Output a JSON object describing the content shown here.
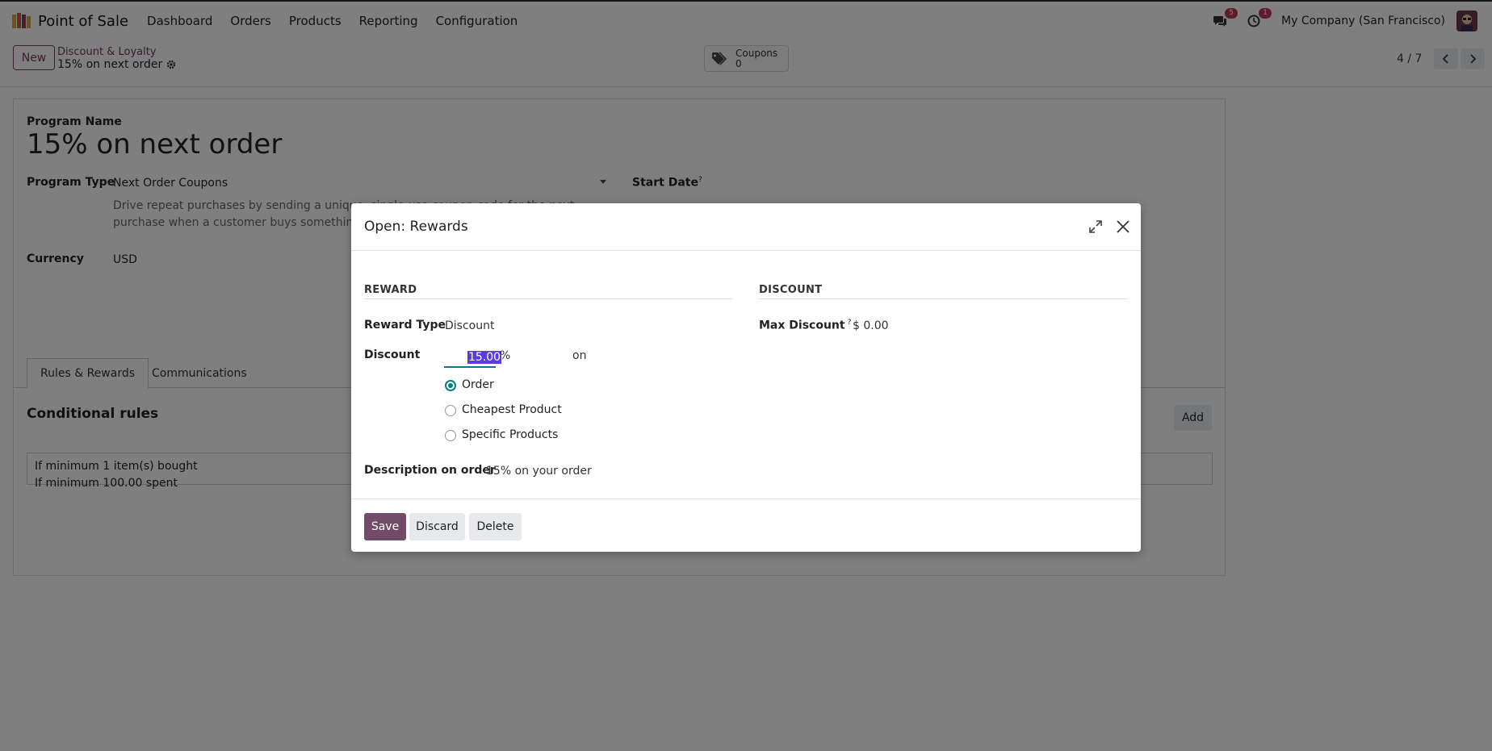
{
  "topbar": {
    "app_name": "Point of Sale",
    "nav": [
      "Dashboard",
      "Orders",
      "Products",
      "Reporting",
      "Configuration"
    ],
    "messages_badge": "5",
    "activity_badge": "1",
    "company": "My Company (San Francisco)"
  },
  "control_panel": {
    "new_label": "New",
    "breadcrumb_parent": "Discount & Loyalty",
    "breadcrumb_current": "15% on next order",
    "coupons_label": "Coupons",
    "coupons_count": "0",
    "pager": "4 / 7"
  },
  "form": {
    "program_name_label": "Program Name",
    "program_name": "15% on next order",
    "program_type_label": "Program Type",
    "program_type": "Next Order Coupons",
    "program_type_desc": "Drive repeat purchases by sending a unique, single-use coupon code for the next purchase when a customer buys something in your store.",
    "start_date_label": "Start Date",
    "start_date_help": "?",
    "currency_label": "Currency",
    "currency": "USD",
    "tabs": [
      "Rules & Rewards",
      "Communications"
    ],
    "conditional_rules_title": "Conditional rules",
    "add_label": "Add",
    "rules": [
      "If minimum 1 item(s) bought",
      "If minimum 100.00 spent"
    ]
  },
  "modal": {
    "title": "Open: Rewards",
    "reward_section": "REWARD",
    "discount_section": "DISCOUNT",
    "reward_type_label": "Reward Type",
    "reward_type": "Discount",
    "discount_label": "Discount",
    "discount_value": "15.00",
    "discount_unit": "%",
    "discount_on": "on",
    "apply_options": [
      "Order",
      "Cheapest Product",
      "Specific Products"
    ],
    "apply_selected": "Order",
    "description_label": "Description on order",
    "description": "15% on your order",
    "max_discount_label": "Max Discount",
    "max_discount_help": "?",
    "max_discount": "$ 0.00",
    "save_label": "Save",
    "discard_label": "Discard",
    "delete_label": "Delete"
  },
  "colors": {
    "brand": "#714b67",
    "accent": "#017e84",
    "badge": "#c3344e",
    "selection": "#5b3be0"
  },
  "icons": [
    "app-logo-icon",
    "chat-icon",
    "clock-icon",
    "gear-icon",
    "tags-icon",
    "chevron-left-icon",
    "chevron-right-icon",
    "caret-down-icon",
    "expand-icon",
    "close-icon"
  ]
}
